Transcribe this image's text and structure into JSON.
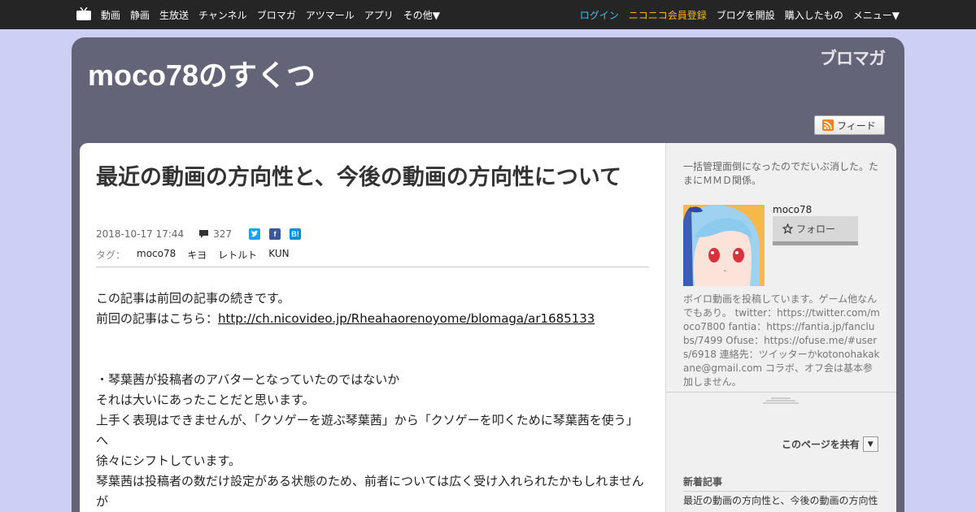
{
  "topbar": {
    "logo_icon": "tv-icon",
    "nav": [
      "動画",
      "静画",
      "生放送",
      "チャンネル",
      "ブロマガ",
      "アツマール",
      "アプリ",
      "その他▼"
    ],
    "login": "ログイン",
    "register": "ニコニコ会員登録",
    "open_blog": "ブログを開設",
    "purchased": "購入したもの",
    "menu": "メニュー▼",
    "colors": {
      "login": "#3fc4e8",
      "register": "#f5b91a"
    }
  },
  "blog": {
    "title": "moco78のすくつ",
    "brand": "ブロマガ",
    "feed_label": "フィード"
  },
  "article": {
    "title": "最近の動画の方向性と、今後の動画の方向性について",
    "date": "2018-10-17 17:44",
    "comment_count": "327",
    "share_icons": [
      {
        "name": "twitter-icon",
        "glyph": "",
        "color": "#1da1f2"
      },
      {
        "name": "facebook-icon",
        "glyph": "f",
        "color": "#3b5998"
      },
      {
        "name": "hatena-bookmark-icon",
        "glyph": "B!",
        "color": "#008fde"
      }
    ],
    "tags_label": "タグ：",
    "tags": [
      "moco78",
      "キヨ",
      "レトルト",
      "KUN"
    ],
    "intro1": "この記事は前回の記事の続きです。",
    "intro2_prefix": "前回の記事はこちら：",
    "intro2_link": "http://ch.nicovideo.jp/Rheahaorenoyome/blomaga/ar1685133",
    "para": [
      "・琴葉茜が投稿者のアバターとなっていたのではないか",
      "それは大いにあったことだと思います。",
      "上手く表現はできませんが、「クソゲーを遊ぶ琴葉茜」から「クソゲーを叩くために琴葉茜を使う」へ",
      "徐々にシフトしています。",
      "琴葉茜は投稿者の数だけ設定がある状態のため、前者については広く受け入れられたかもしれませんが"
    ]
  },
  "sidebar": {
    "desc": "一括管理面倒になったのでだいぶ消した。たまにＭＭＤ関係。",
    "username": "moco78",
    "follow_label": "フォロー",
    "profile": "ボイロ動画を投稿しています。ゲーム他なんでもあり。 twitter：https://twitter.com/moco7800 fantia：https://fantia.jp/fanclubs/7499 Ofuse：https://ofuse.me/#users/6918 連絡先：ツイッターかkotonohakakane@gmail.com コラボ、オフ会は基本参加しません。",
    "share_page": "このページを共有",
    "share_dd": "▼",
    "recent_heading": "新着記事",
    "recent_item": "最近の動画の方向性と、今後の動画の方向性"
  }
}
